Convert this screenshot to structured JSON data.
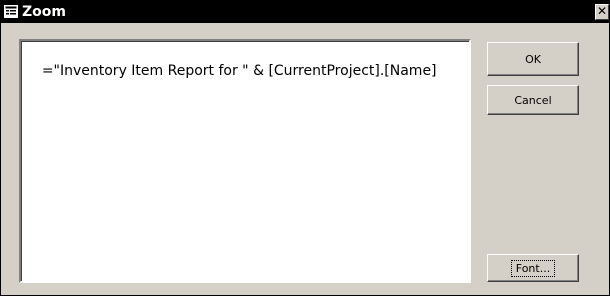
{
  "window": {
    "title": "Zoom",
    "close_glyph": "✕",
    "title_icon": "form-icon"
  },
  "editor": {
    "value": "=\"Inventory Item Report for \" & [CurrentProject].[Name]"
  },
  "buttons": {
    "ok_label": "OK",
    "cancel_label": "Cancel",
    "font_label": "Font..."
  },
  "colors": {
    "title_bar": "#000000",
    "dialog_face": "#d4d0c8",
    "editor_background": "#ffffff"
  }
}
